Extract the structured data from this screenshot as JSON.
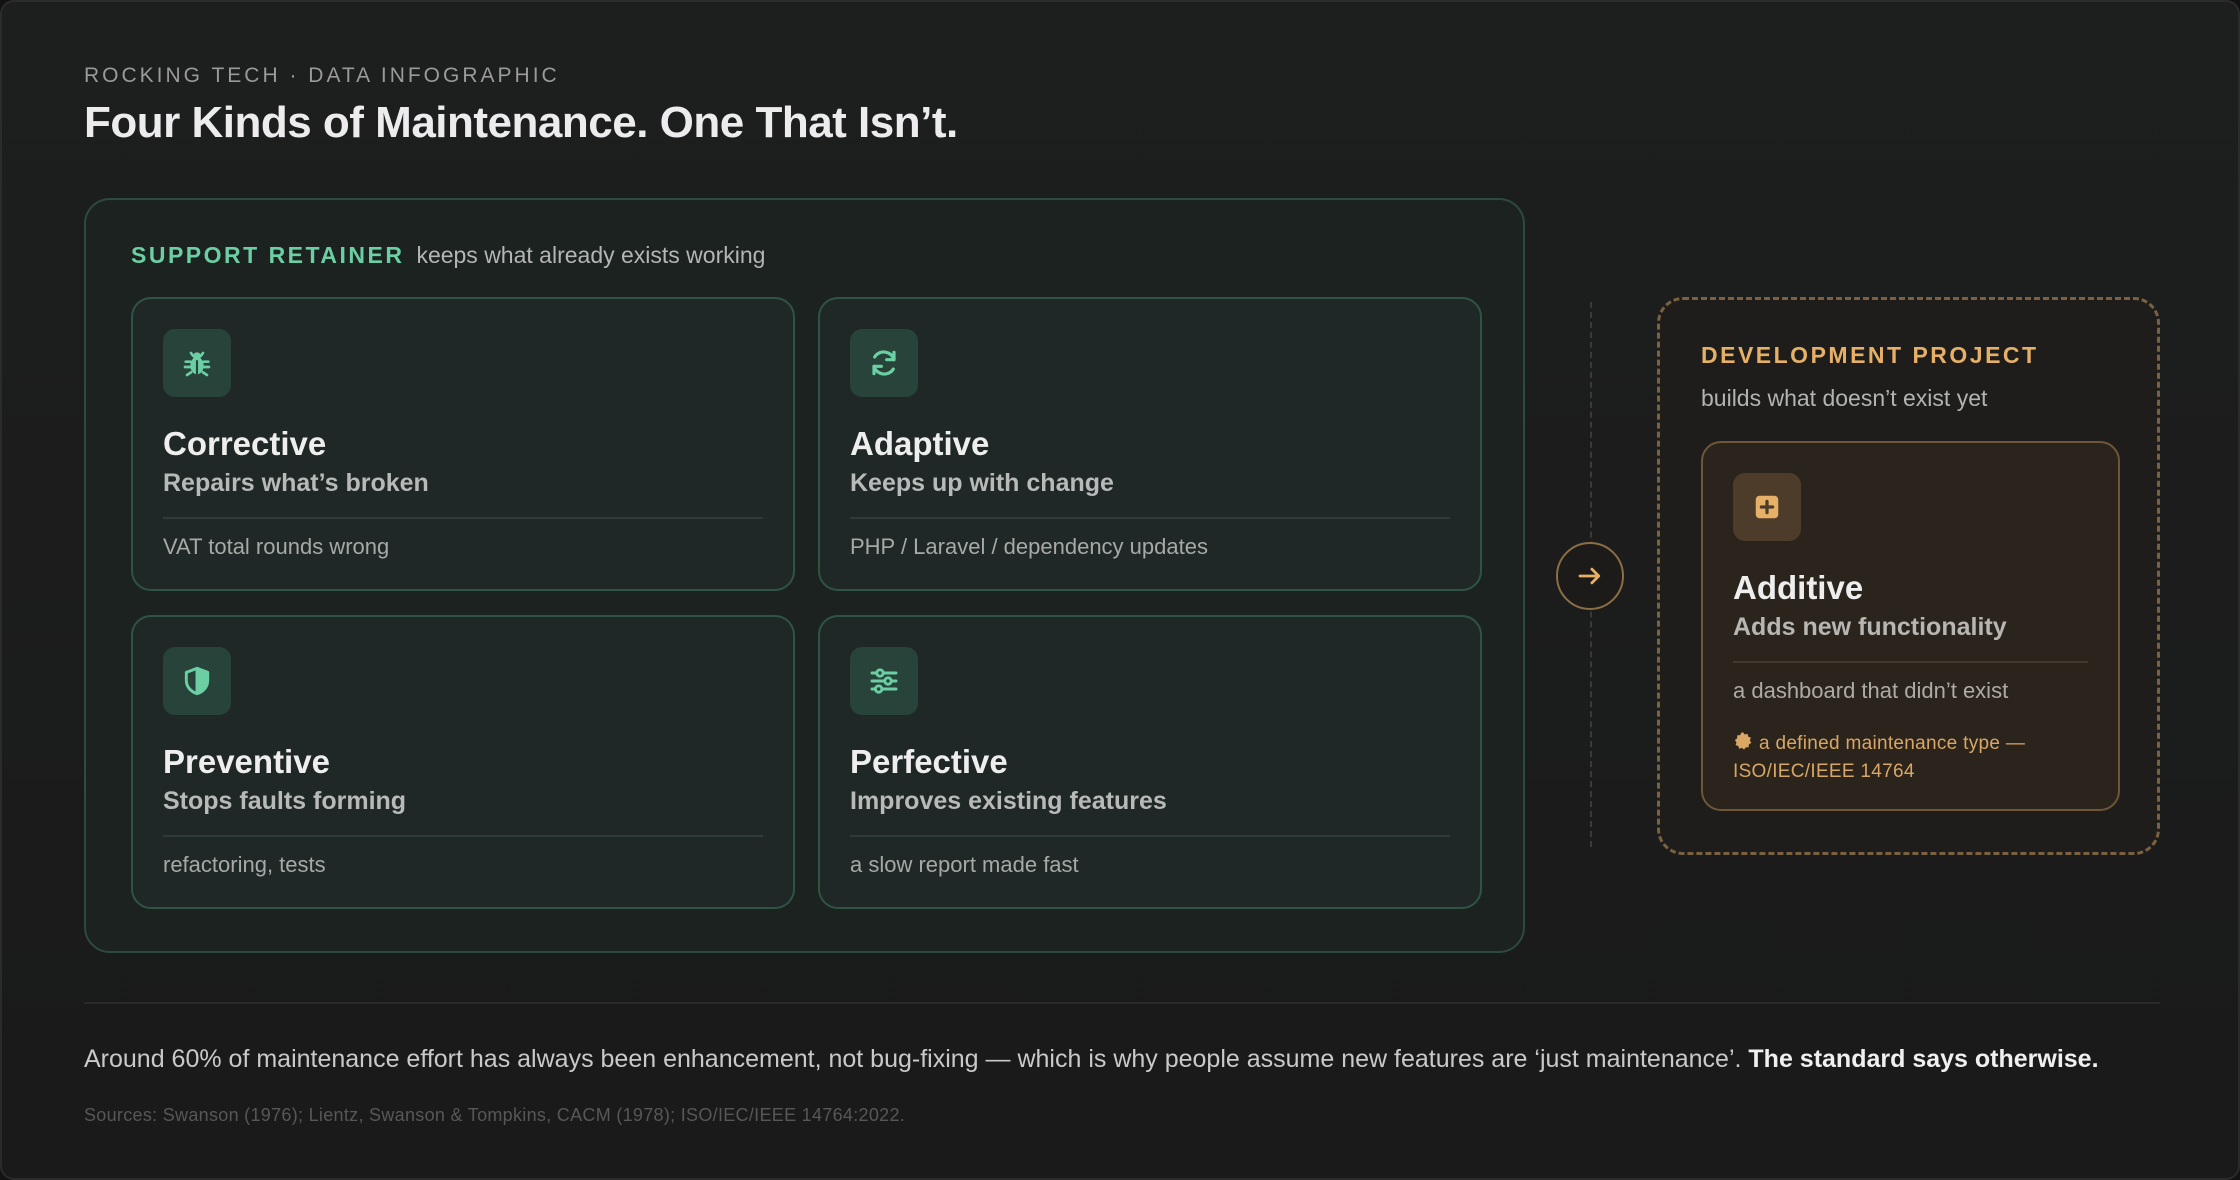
{
  "header": {
    "eyebrow": "ROCKING TECH · DATA INFOGRAPHIC",
    "title": "Four Kinds of Maintenance. One That Isn’t."
  },
  "retainer": {
    "tag": "SUPPORT RETAINER",
    "description": "keeps what already exists working",
    "accent_color": "#6ccfa4",
    "cards": [
      {
        "icon": "bug-icon",
        "title": "Corrective",
        "subtitle": "Repairs what’s broken",
        "example": "VAT total rounds wrong"
      },
      {
        "icon": "refresh-icon",
        "title": "Adaptive",
        "subtitle": "Keeps up with change",
        "example": "PHP / Laravel / dependency updates"
      },
      {
        "icon": "shield-icon",
        "title": "Preventive",
        "subtitle": "Stops faults forming",
        "example": "refactoring, tests"
      },
      {
        "icon": "sliders-icon",
        "title": "Perfective",
        "subtitle": "Improves existing features",
        "example": "a slow report made fast"
      }
    ]
  },
  "connector": {
    "icon": "arrow-right-icon"
  },
  "development": {
    "tag": "DEVELOPMENT PROJECT",
    "description": "builds what doesn’t exist yet",
    "accent_color": "#e6b067",
    "card": {
      "icon": "plus-square-icon",
      "title": "Additive",
      "subtitle": "Adds new functionality",
      "example": "a dashboard that didn’t exist",
      "note": "a defined maintenance type — ISO/IEC/IEEE 14764"
    }
  },
  "footer": {
    "text": "Around 60% of maintenance effort has always been enhancement, not bug-fixing — which is why people assume new features are ‘just maintenance’.",
    "emphasis": "The standard says otherwise.",
    "sources": "Sources: Swanson (1976); Lientz, Swanson & Tompkins, CACM (1978); ISO/IEC/IEEE 14764:2022."
  }
}
